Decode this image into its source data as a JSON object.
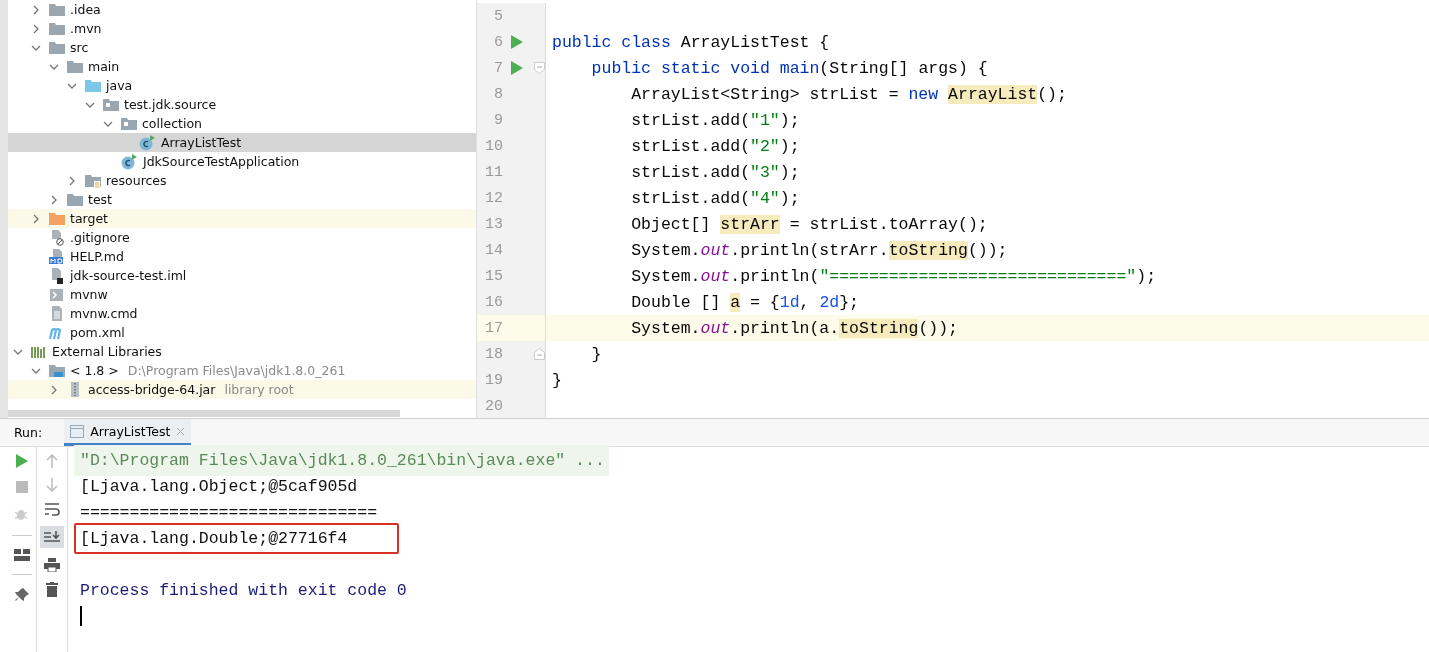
{
  "project_tree": {
    "project_items": [
      {
        "label": ".idea",
        "kind": "folder",
        "expanded": false,
        "selected": false,
        "highlighted": false
      },
      {
        "label": ".mvn",
        "kind": "folder",
        "expanded": false,
        "selected": false,
        "highlighted": false
      },
      {
        "label": "src",
        "kind": "folder",
        "expanded": true,
        "selected": false,
        "highlighted": false,
        "children": [
          {
            "label": "main",
            "kind": "folder",
            "expanded": true,
            "selected": false,
            "highlighted": false,
            "children": [
              {
                "label": "java",
                "kind": "source-folder",
                "expanded": true,
                "selected": false,
                "highlighted": false,
                "children": [
                  {
                    "label": "test.jdk.source",
                    "kind": "package",
                    "expanded": true,
                    "selected": false,
                    "highlighted": false,
                    "children": [
                      {
                        "label": "collection",
                        "kind": "package",
                        "expanded": true,
                        "selected": false,
                        "highlighted": false,
                        "children": [
                          {
                            "label": "ArrayListTest",
                            "kind": "class",
                            "selected": true,
                            "highlighted": false
                          }
                        ]
                      },
                      {
                        "label": "JdkSourceTestApplication",
                        "kind": "class",
                        "selected": false,
                        "highlighted": false
                      }
                    ]
                  }
                ]
              },
              {
                "label": "resources",
                "kind": "resources-folder",
                "expanded": false,
                "selected": false,
                "highlighted": false
              }
            ]
          },
          {
            "label": "test",
            "kind": "folder",
            "expanded": false,
            "selected": false,
            "highlighted": false
          }
        ]
      },
      {
        "label": "target",
        "kind": "excluded-folder",
        "expanded": false,
        "selected": false,
        "highlighted": true
      },
      {
        "label": ".gitignore",
        "kind": "ignore-file",
        "selected": false,
        "highlighted": false
      },
      {
        "label": "HELP.md",
        "kind": "markdown-file",
        "selected": false,
        "highlighted": false
      },
      {
        "label": "jdk-source-test.iml",
        "kind": "module-file",
        "selected": false,
        "highlighted": false
      },
      {
        "label": "mvnw",
        "kind": "script-file",
        "selected": false,
        "highlighted": false
      },
      {
        "label": "mvnw.cmd",
        "kind": "text-file",
        "selected": false,
        "highlighted": false
      },
      {
        "label": "pom.xml",
        "kind": "maven-file",
        "selected": false,
        "highlighted": false
      }
    ],
    "libraries": [
      {
        "label": "External Libraries",
        "kind": "libraries",
        "expanded": true,
        "selected": false,
        "highlighted": false,
        "children": [
          {
            "label": "< 1.8 >",
            "hint": "D:\\Program Files\\Java\\jdk1.8.0_261",
            "kind": "sdk",
            "expanded": true,
            "selected": false,
            "highlighted": false,
            "children": [
              {
                "label": "access-bridge-64.jar",
                "hint": "library root",
                "kind": "jar",
                "expanded": false,
                "selected": false,
                "highlighted": true
              }
            ]
          }
        ]
      }
    ]
  },
  "editor": {
    "lines": [
      {
        "number": "5",
        "run": false,
        "fold_open": false,
        "fold_close": false,
        "current": false
      },
      {
        "number": "6",
        "run": true,
        "fold_open": false,
        "fold_close": false,
        "current": false,
        "tokens": [
          {
            "text": "public class ",
            "kind": "keyword"
          },
          {
            "text": "ArrayListTest {",
            "kind": "plain"
          }
        ]
      },
      {
        "number": "7",
        "run": true,
        "fold_open": true,
        "fold_close": false,
        "current": false,
        "tokens": [
          {
            "text": "    public static void ",
            "kind": "keyword"
          },
          {
            "text": "main",
            "kind": "keyword"
          },
          {
            "text": "(String[] args) {",
            "kind": "plain"
          }
        ]
      },
      {
        "number": "8",
        "run": false,
        "fold_open": false,
        "fold_close": false,
        "current": false,
        "tokens": [
          {
            "text": "        ArrayList<String> strList = ",
            "kind": "plain"
          },
          {
            "text": "new ",
            "kind": "keyword"
          },
          {
            "text": "ArrayList",
            "kind": "warning"
          },
          {
            "text": "();",
            "kind": "plain"
          }
        ]
      },
      {
        "number": "9",
        "run": false,
        "fold_open": false,
        "fold_close": false,
        "current": false,
        "tokens": [
          {
            "text": "        strList.add(",
            "kind": "plain"
          },
          {
            "text": "\"1\"",
            "kind": "string"
          },
          {
            "text": ");",
            "kind": "plain"
          }
        ]
      },
      {
        "number": "10",
        "run": false,
        "fold_open": false,
        "fold_close": false,
        "current": false,
        "tokens": [
          {
            "text": "        strList.add(",
            "kind": "plain"
          },
          {
            "text": "\"2\"",
            "kind": "string"
          },
          {
            "text": ");",
            "kind": "plain"
          }
        ]
      },
      {
        "number": "11",
        "run": false,
        "fold_open": false,
        "fold_close": false,
        "current": false,
        "tokens": [
          {
            "text": "        strList.add(",
            "kind": "plain"
          },
          {
            "text": "\"3\"",
            "kind": "string"
          },
          {
            "text": ");",
            "kind": "plain"
          }
        ]
      },
      {
        "number": "12",
        "run": false,
        "fold_open": false,
        "fold_close": false,
        "current": false,
        "tokens": [
          {
            "text": "        strList.add(",
            "kind": "plain"
          },
          {
            "text": "\"4\"",
            "kind": "string"
          },
          {
            "text": ");",
            "kind": "plain"
          }
        ]
      },
      {
        "number": "13",
        "run": false,
        "fold_open": false,
        "fold_close": false,
        "current": false,
        "tokens": [
          {
            "text": "        Object[] ",
            "kind": "plain"
          },
          {
            "text": "strArr",
            "kind": "warning"
          },
          {
            "text": " = strList.toArray();",
            "kind": "plain"
          }
        ]
      },
      {
        "number": "14",
        "run": false,
        "fold_open": false,
        "fold_close": false,
        "current": false,
        "tokens": [
          {
            "text": "        System.",
            "kind": "plain"
          },
          {
            "text": "out",
            "kind": "field"
          },
          {
            "text": ".println(strArr.",
            "kind": "plain"
          },
          {
            "text": "toString",
            "kind": "warning"
          },
          {
            "text": "());",
            "kind": "plain"
          }
        ]
      },
      {
        "number": "15",
        "run": false,
        "fold_open": false,
        "fold_close": false,
        "current": false,
        "tokens": [
          {
            "text": "        System.",
            "kind": "plain"
          },
          {
            "text": "out",
            "kind": "field"
          },
          {
            "text": ".println(",
            "kind": "plain"
          },
          {
            "text": "\"==============================\"",
            "kind": "string"
          },
          {
            "text": ");",
            "kind": "plain"
          }
        ]
      },
      {
        "number": "16",
        "run": false,
        "fold_open": false,
        "fold_close": false,
        "current": false,
        "tokens": [
          {
            "text": "        Double [] ",
            "kind": "plain"
          },
          {
            "text": "a",
            "kind": "warning"
          },
          {
            "text": " = {",
            "kind": "plain"
          },
          {
            "text": "1d",
            "kind": "number"
          },
          {
            "text": ", ",
            "kind": "plain"
          },
          {
            "text": "2d",
            "kind": "number"
          },
          {
            "text": "};",
            "kind": "plain"
          }
        ]
      },
      {
        "number": "17",
        "run": false,
        "fold_open": false,
        "fold_close": false,
        "current": true,
        "tokens": [
          {
            "text": "        System.",
            "kind": "plain"
          },
          {
            "text": "out",
            "kind": "field"
          },
          {
            "text": ".println(a.",
            "kind": "plain"
          },
          {
            "text": "toString",
            "kind": "warning"
          },
          {
            "text": "());",
            "kind": "plain"
          }
        ]
      },
      {
        "number": "18",
        "run": false,
        "fold_open": false,
        "fold_close": true,
        "current": false,
        "tokens": [
          {
            "text": "    }",
            "kind": "plain"
          }
        ]
      },
      {
        "number": "19",
        "run": false,
        "fold_open": false,
        "fold_close": false,
        "current": false,
        "tokens": [
          {
            "text": "}",
            "kind": "plain"
          }
        ]
      },
      {
        "number": "20",
        "run": false,
        "fold_open": false,
        "fold_close": false,
        "current": false
      }
    ]
  },
  "run_panel": {
    "label": "Run:",
    "tabs": [
      {
        "label": "ArrayListTest",
        "selected": true
      }
    ],
    "console": [
      {
        "kind": "command",
        "text": "\"D:\\Program Files\\Java\\jdk1.8.0_261\\bin\\java.exe\" ...",
        "boxed": false
      },
      {
        "kind": "output",
        "text": "[Ljava.lang.Object;@5caf905d",
        "boxed": false
      },
      {
        "kind": "output",
        "text": "==============================",
        "boxed": false
      },
      {
        "kind": "output",
        "text": "[Ljava.lang.Double;@27716f4",
        "boxed": true
      },
      {
        "kind": "blank"
      },
      {
        "kind": "system",
        "text": "Process finished with exit code 0",
        "boxed": false
      },
      {
        "kind": "cursor"
      }
    ]
  }
}
